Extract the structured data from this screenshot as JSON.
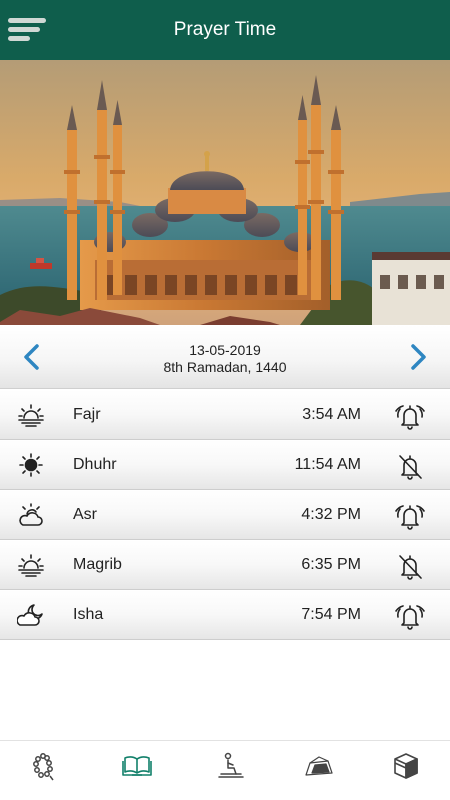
{
  "header": {
    "title": "Prayer Time",
    "menu_icon": "hamburger-menu-icon"
  },
  "hero": {
    "image": "blue-mosque-sunset-photo"
  },
  "date_nav": {
    "gregorian": "13-05-2019",
    "hijri": "8th Ramadan, 1440",
    "prev_icon": "chevron-left-icon",
    "next_icon": "chevron-right-icon"
  },
  "prayers": [
    {
      "name": "Fajr",
      "time": "3:54 AM",
      "icon": "sunrise-icon",
      "alarm": "on"
    },
    {
      "name": "Dhuhr",
      "time": "11:54 AM",
      "icon": "sun-icon",
      "alarm": "off"
    },
    {
      "name": "Asr",
      "time": "4:32 PM",
      "icon": "partly-cloudy-icon",
      "alarm": "on"
    },
    {
      "name": "Magrib",
      "time": "6:35 PM",
      "icon": "sunset-icon",
      "alarm": "off"
    },
    {
      "name": "Isha",
      "time": "7:54 PM",
      "icon": "cloudy-moon-icon",
      "alarm": "on"
    }
  ],
  "bottom_nav": [
    {
      "icon": "tasbih-beads-icon",
      "active": false
    },
    {
      "icon": "quran-book-icon",
      "active": true
    },
    {
      "icon": "praying-person-icon",
      "active": false
    },
    {
      "icon": "mosque-icon",
      "active": false
    },
    {
      "icon": "kaaba-icon",
      "active": false
    }
  ],
  "colors": {
    "primary": "#0f5e4c",
    "accent": "#2e86c1",
    "active_tab": "#12806a"
  }
}
